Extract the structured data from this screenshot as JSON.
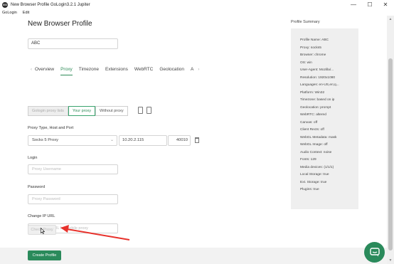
{
  "window": {
    "title": "New Browser Profile GoLogin3.2.1 Jupiter",
    "icon_text": "GO"
  },
  "menu": [
    "GoLogin",
    "Edit"
  ],
  "page": {
    "title": "New Browser Profile",
    "profile_name_value": "ABC"
  },
  "tabs": [
    "Overview",
    "Proxy",
    "Timezone",
    "Extensions",
    "WebRTC",
    "Geolocation",
    "A"
  ],
  "active_tab": "Proxy",
  "proxy_mode": {
    "gologin": "Gologin proxy lists",
    "your": "Your proxy",
    "without": "Without proxy"
  },
  "proxy": {
    "type_label": "Proxy Type, Host and Port",
    "type_value": "Socks 5 Proxy",
    "host_value": "10.20.2.115",
    "port_value": "40010",
    "login_label": "Login",
    "login_placeholder": "Proxy Username",
    "password_label": "Password",
    "password_placeholder": "Proxy Password",
    "change_ip_label": "Change IP URL",
    "change_ip_placeholder": "Change IP URL for mobile proxy",
    "check_button": "Check Proxy"
  },
  "footer": {
    "create_button": "Create Profile"
  },
  "summary": {
    "title": "Profile Summary",
    "rows": [
      "Profile Name: ABC",
      "Proxy: socks5",
      "Browser: chrome",
      "OS: win",
      "User-Agent: Mozilla/...",
      "Resolution: 1920x1080",
      "Languages: en-US,en;q...",
      "Platform: Win32",
      "Timezone: based on ip",
      "Geolocation: prompt",
      "WebRTC: altered",
      "Canvas: off",
      "Client Rects: off",
      "WebGL Metadata: mask",
      "WebGL Image: off",
      "Audio Context: noise",
      "Fonts: 129",
      "Media devices: (1/1/1)",
      "Local Storage: true",
      "Ext. Storage: true",
      "Plugins: true"
    ]
  },
  "colors": {
    "accent": "#2a8a5b",
    "arrow": "#e8322c",
    "summary_bg": "#efefef"
  },
  "icons": [
    "minimize-icon",
    "maximize-icon",
    "close-icon",
    "copy-icon",
    "table-icon",
    "chevron-down-icon",
    "trash-icon",
    "chat-icon",
    "cursor-icon",
    "red-arrow-annotation"
  ]
}
